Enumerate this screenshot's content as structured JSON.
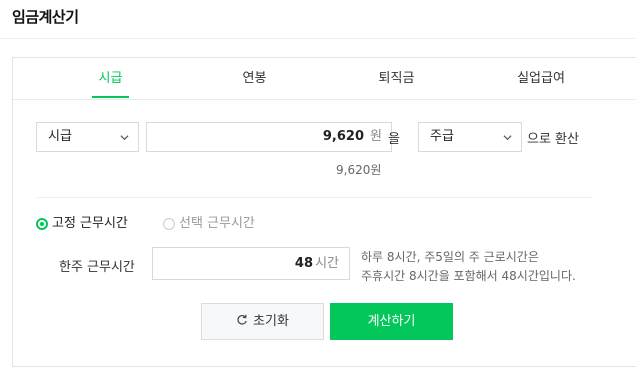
{
  "page": {
    "title": "임금계산기"
  },
  "tabs": [
    {
      "label": "시급",
      "active": true
    },
    {
      "label": "연봉",
      "active": false
    },
    {
      "label": "퇴직금",
      "active": false
    },
    {
      "label": "실업급여",
      "active": false
    }
  ],
  "converter": {
    "unit_select": "시급",
    "amount": "9,620",
    "amount_unit": "원",
    "particle": "을",
    "target_select": "주급",
    "suffix": "으로 환산",
    "amount_display": "9,620원"
  },
  "work_time": {
    "options": [
      {
        "label": "고정 근무시간",
        "selected": true
      },
      {
        "label": "선택 근무시간",
        "selected": false
      }
    ],
    "weekly_label": "한주 근무시간",
    "weekly_hours": "48",
    "weekly_unit": "시간",
    "hint_line1": "하루 8시간, 주5일의 주 근로시간은",
    "hint_line2": "주휴시간 8시간을 포함해서 48시간입니다."
  },
  "buttons": {
    "reset": "초기화",
    "calculate": "계산하기"
  },
  "colors": {
    "accent": "#03c75a",
    "border": "#d9d9d9"
  }
}
